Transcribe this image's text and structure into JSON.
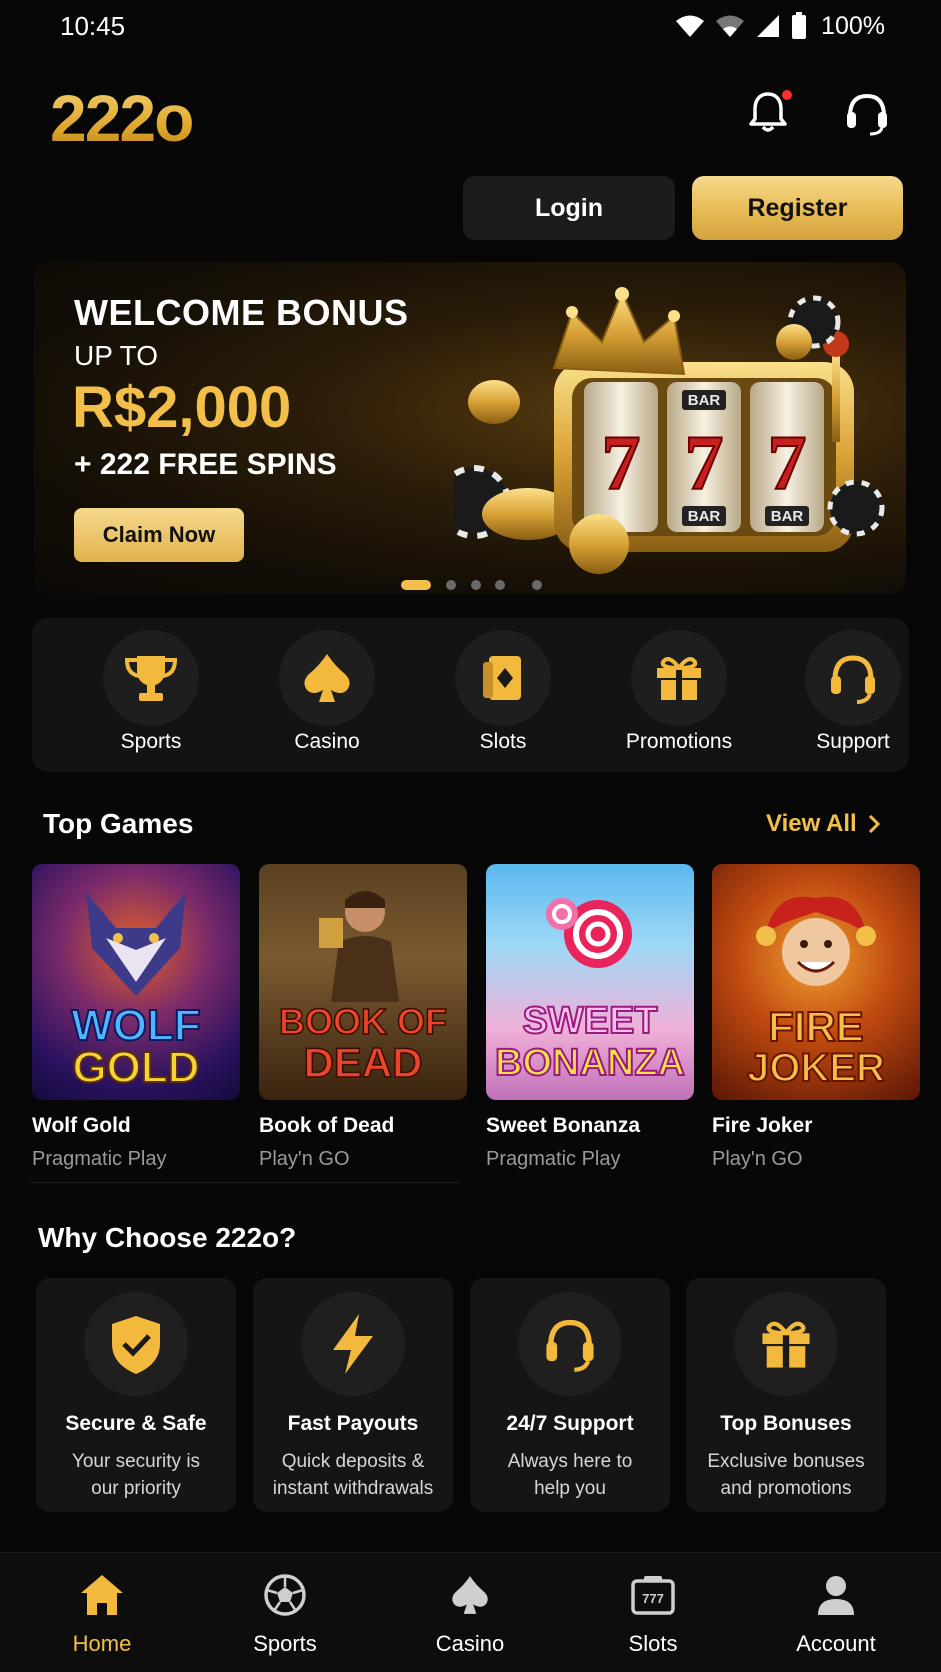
{
  "status_bar": {
    "time": "10:45",
    "battery": "100%"
  },
  "header": {
    "logo": "222o"
  },
  "auth": {
    "login": "Login",
    "register": "Register"
  },
  "banner": {
    "title": "WELCOME BONUS",
    "up_to": "UP TO",
    "amount": "R$2,000",
    "spins": "+ 222 FREE SPINS",
    "cta": "Claim Now",
    "slot_symbols": [
      "BAR",
      "7",
      "7",
      "7",
      "BAR",
      "BAR"
    ],
    "carousel_active": 1,
    "carousel_count": 5
  },
  "quick_nav": [
    {
      "label": "Sports",
      "icon": "trophy-icon"
    },
    {
      "label": "Casino",
      "icon": "spade-icon"
    },
    {
      "label": "Slots",
      "icon": "card-icon"
    },
    {
      "label": "Promotions",
      "icon": "gift-icon"
    },
    {
      "label": "Support",
      "icon": "headset-icon"
    }
  ],
  "top_games": {
    "title": "Top Games",
    "view_all": "View All",
    "games": [
      {
        "name": "Wolf Gold",
        "provider": "Pragmatic Play",
        "art_line1": "WOLF",
        "art_line2": "GOLD",
        "art_mark": "™"
      },
      {
        "name": "Book of Dead",
        "provider": "Play'n GO",
        "art_line1": "BOOK OF",
        "art_line2": "DEAD"
      },
      {
        "name": "Sweet Bonanza",
        "provider": "Pragmatic Play",
        "art_line1": "SWEET",
        "art_line2": "BONANZA"
      },
      {
        "name": "Fire Joker",
        "provider": "Play'n GO",
        "art_line1": "FIRE",
        "art_line2": "JOKER"
      }
    ]
  },
  "why": {
    "title": "Why Choose 222o?",
    "items": [
      {
        "title": "Secure & Safe",
        "desc1": "Your security is",
        "desc2": "our priority",
        "icon": "shield-check-icon"
      },
      {
        "title": "Fast Payouts",
        "desc1": "Quick deposits &",
        "desc2": "instant withdrawals",
        "icon": "lightning-icon"
      },
      {
        "title": "24/7 Support",
        "desc1": "Always here to",
        "desc2": "help you",
        "icon": "headset-icon"
      },
      {
        "title": "Top Bonuses",
        "desc1": "Exclusive bonuses",
        "desc2": "and promotions",
        "icon": "gift-icon"
      }
    ]
  },
  "bottom_nav": [
    {
      "label": "Home",
      "icon": "home-icon",
      "active": true
    },
    {
      "label": "Sports",
      "icon": "soccer-ball-icon",
      "active": false
    },
    {
      "label": "Casino",
      "icon": "spade-icon",
      "active": false
    },
    {
      "label": "Slots",
      "icon": "slot-machine-icon",
      "active": false
    },
    {
      "label": "Account",
      "icon": "user-icon",
      "active": false
    }
  ],
  "colors": {
    "accent": "#f2c04a",
    "background": "#070707",
    "card": "#151515"
  }
}
